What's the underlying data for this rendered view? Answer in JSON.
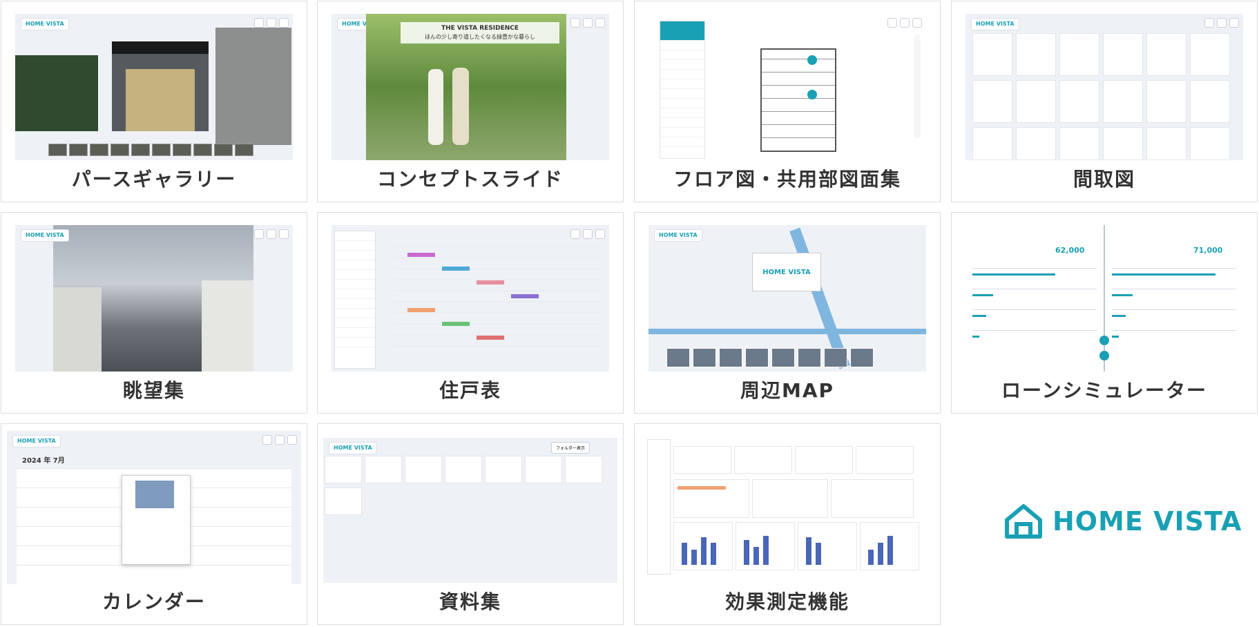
{
  "cards": [
    {
      "caption": "パースギャラリー"
    },
    {
      "caption": "コンセプトスライド"
    },
    {
      "caption": "フロア図・共用部図面集"
    },
    {
      "caption": "間取図"
    },
    {
      "caption": "眺望集"
    },
    {
      "caption": "住戸表"
    },
    {
      "caption": "周辺MAP"
    },
    {
      "caption": "ローンシミュレーター"
    },
    {
      "caption": "カレンダー"
    },
    {
      "caption": "資料集"
    },
    {
      "caption": "効果測定機能"
    }
  ],
  "brand": {
    "name": "HOME VISTA"
  },
  "thumb_text": {
    "logo": "HOME VISTA",
    "concept_title": "THE VISTA RESIDENCE",
    "concept_sub": "ほんの少し寄り道したくなる緑豊かな暮らし",
    "calendar_month": "2024 年 7月",
    "loan_amount_1": "62,000",
    "loan_amount_2": "71,000",
    "folder_label": "フォルダー表示"
  },
  "colors": {
    "accent": "#1aa0b4",
    "text": "#333333",
    "border": "#d9dde2"
  }
}
